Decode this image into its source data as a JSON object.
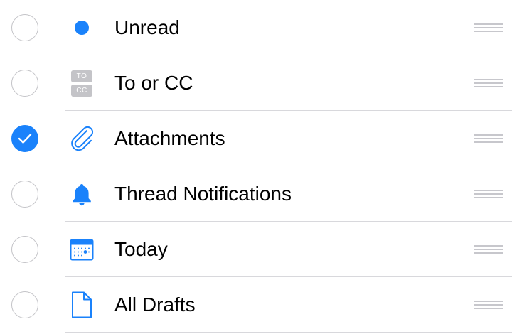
{
  "filters": [
    {
      "label": "Unread",
      "checked": false,
      "icon": "unread-dot-icon"
    },
    {
      "label": "To or CC",
      "checked": false,
      "icon": "to-cc-icon",
      "badge_top": "TO",
      "badge_bottom": "CC"
    },
    {
      "label": "Attachments",
      "checked": true,
      "icon": "paperclip-icon"
    },
    {
      "label": "Thread Notifications",
      "checked": false,
      "icon": "bell-icon"
    },
    {
      "label": "Today",
      "checked": false,
      "icon": "calendar-icon"
    },
    {
      "label": "All Drafts",
      "checked": false,
      "icon": "document-icon"
    }
  ],
  "colors": {
    "accent": "#1a82fb",
    "unchecked_border": "#c4c4c8",
    "divider": "#d8d8dc",
    "handle": "#c7c7cc"
  }
}
